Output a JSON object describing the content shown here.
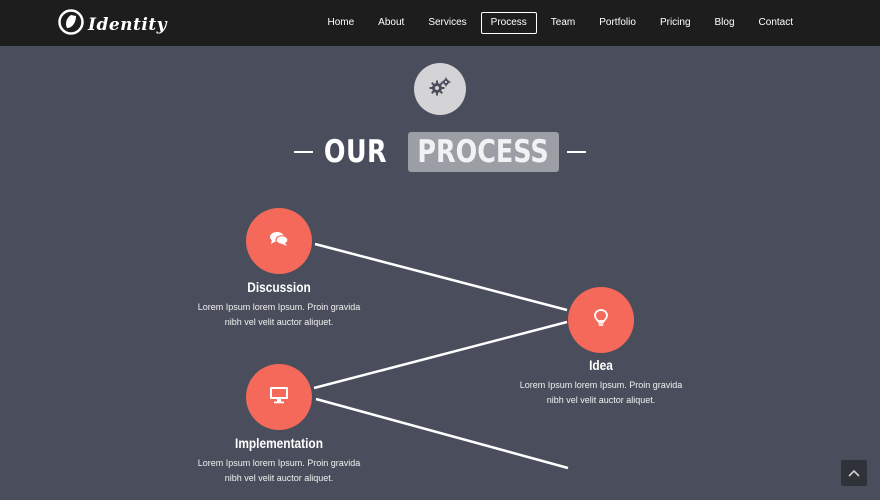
{
  "brand": {
    "name": "Identity"
  },
  "nav": {
    "items": [
      {
        "label": "Home"
      },
      {
        "label": "About"
      },
      {
        "label": "Services"
      },
      {
        "label": "Process",
        "active": true
      },
      {
        "label": "Team"
      },
      {
        "label": "Portfolio"
      },
      {
        "label": "Pricing"
      },
      {
        "label": "Blog"
      },
      {
        "label": "Contact"
      }
    ]
  },
  "section": {
    "icon": "gears-icon",
    "title_plain": "OUR",
    "title_highlight": "PROCESS"
  },
  "steps": {
    "discussion": {
      "title": "Discussion",
      "desc_line1": "Lorem Ipsum lorem Ipsum. Proin gravida",
      "desc_line2": "nibh vel velit auctor aliquet.",
      "icon": "chat-icon"
    },
    "idea": {
      "title": "Idea",
      "desc_line1": "Lorem Ipsum lorem Ipsum. Proin gravida",
      "desc_line2": "nibh vel velit auctor aliquet.",
      "icon": "lightbulb-icon"
    },
    "implementation": {
      "title": "Implementation",
      "desc_line1": "Lorem Ipsum lorem Ipsum. Proin gravida",
      "desc_line2": "nibh vel velit auctor aliquet.",
      "icon": "monitor-icon"
    }
  },
  "colors": {
    "background": "#4a4e5c",
    "navbar": "#1d1d1d",
    "accent": "#f4695a",
    "highlight_box": "#9c9ea6"
  }
}
